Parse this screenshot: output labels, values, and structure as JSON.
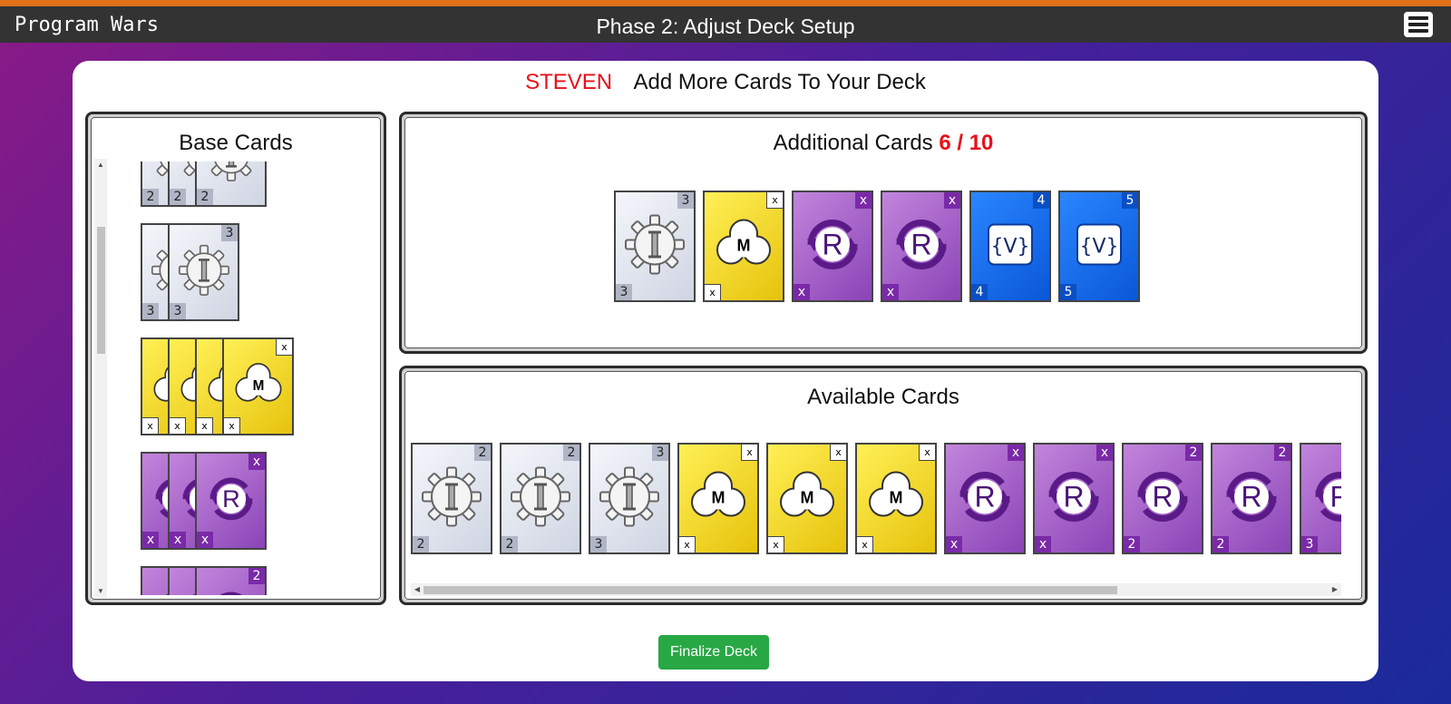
{
  "navbar": {
    "brand": "Program Wars",
    "title": "Phase 2: Adjust Deck Setup"
  },
  "header": {
    "player": "STEVEN",
    "message": "Add More Cards To Your Deck"
  },
  "base_cards": {
    "title": "Base Cards",
    "stacks": [
      {
        "type": "gray",
        "symbol": "gear-instruction",
        "value": "2",
        "count": 3
      },
      {
        "type": "gray",
        "symbol": "gear-instruction",
        "value": "3",
        "count": 2
      },
      {
        "type": "yellow",
        "symbol": "cloud-method",
        "value": "x",
        "count": 4
      },
      {
        "type": "purple",
        "symbol": "repeat-loop",
        "value": "x",
        "count": 3
      },
      {
        "type": "purple",
        "symbol": "repeat-loop",
        "value": "2",
        "count": 3
      }
    ]
  },
  "additional": {
    "title": "Additional Cards",
    "count": "6 / 10",
    "cards": [
      {
        "type": "gray",
        "symbol": "gear-instruction",
        "value": "3"
      },
      {
        "type": "yellow",
        "symbol": "cloud-method",
        "value": "x"
      },
      {
        "type": "purple",
        "symbol": "repeat-loop",
        "value": "x"
      },
      {
        "type": "purple",
        "symbol": "repeat-loop",
        "value": "x"
      },
      {
        "type": "blue",
        "symbol": "variable",
        "value": "4"
      },
      {
        "type": "blue",
        "symbol": "variable",
        "value": "5"
      }
    ]
  },
  "available": {
    "title": "Available Cards",
    "cards": [
      {
        "type": "gray",
        "symbol": "gear-instruction",
        "value": "2"
      },
      {
        "type": "gray",
        "symbol": "gear-instruction",
        "value": "2"
      },
      {
        "type": "gray",
        "symbol": "gear-instruction",
        "value": "3"
      },
      {
        "type": "yellow",
        "symbol": "cloud-method",
        "value": "x"
      },
      {
        "type": "yellow",
        "symbol": "cloud-method",
        "value": "x"
      },
      {
        "type": "yellow",
        "symbol": "cloud-method",
        "value": "x"
      },
      {
        "type": "purple",
        "symbol": "repeat-loop",
        "value": "x"
      },
      {
        "type": "purple",
        "symbol": "repeat-loop",
        "value": "x"
      },
      {
        "type": "purple",
        "symbol": "repeat-loop",
        "value": "2"
      },
      {
        "type": "purple",
        "symbol": "repeat-loop",
        "value": "2"
      },
      {
        "type": "purple",
        "symbol": "repeat-loop",
        "value": "3"
      }
    ]
  },
  "symbols": {
    "method_letter": "M",
    "repeat_letter": "R",
    "variable_label": "{V}"
  },
  "finalize_label": "Finalize Deck",
  "colors": {
    "accent_bar": "#e0701a",
    "count_red": "#e8101a",
    "finalize_green": "#28a745"
  }
}
